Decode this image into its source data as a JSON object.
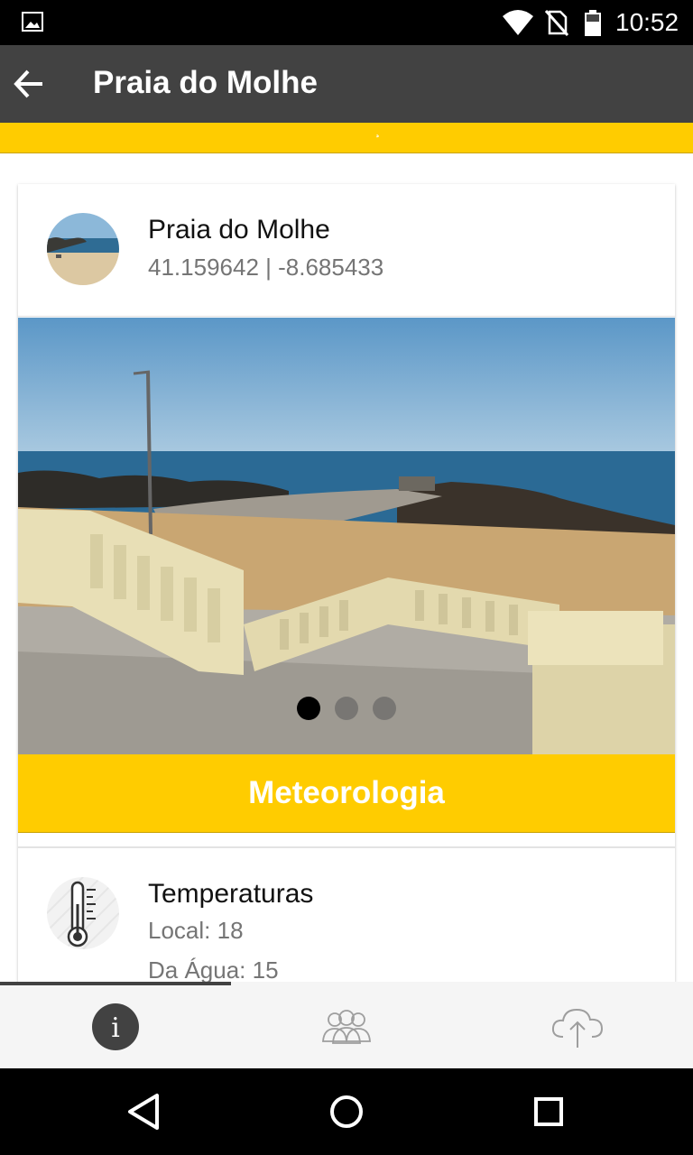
{
  "status_bar": {
    "time": "10:52",
    "icons": [
      "image-notification-icon",
      "wifi-icon",
      "no-sim-icon",
      "battery-icon"
    ]
  },
  "app_bar": {
    "title": "Praia do Molhe",
    "back_icon": "arrow-back-icon"
  },
  "card": {
    "title": "Praia do Molhe",
    "coordinates": "41.159642 | -8.685433",
    "carousel": {
      "page_count": 3,
      "active_index": 0
    },
    "section_label": "Meteorologia",
    "temperature": {
      "title": "Temperaturas",
      "local": "Local: 18",
      "water": "Da Água: 15"
    }
  },
  "tabs": [
    {
      "icon": "info-icon",
      "active": true
    },
    {
      "icon": "community-icon",
      "active": false
    },
    {
      "icon": "cloud-upload-icon",
      "active": false
    }
  ],
  "colors": {
    "accent": "#FFCC00",
    "app_bar": "#424242",
    "secondary_text": "#757575"
  }
}
